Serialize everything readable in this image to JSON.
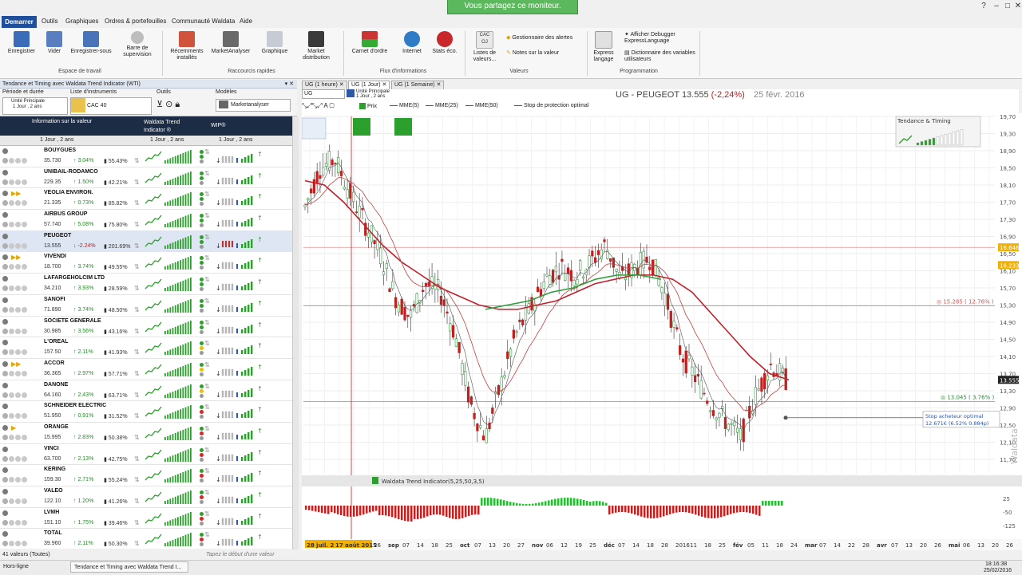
{
  "banner": "Vous partagez ce moniteur.",
  "menu": {
    "demarrer": "Demarrer",
    "items": [
      "Outils",
      "Graphiques",
      "Ordres & portefeuilles",
      "Communauté Waldata",
      "Aide"
    ]
  },
  "ribbon": {
    "buttons": [
      {
        "label": "Enregistrer"
      },
      {
        "label": "Vider"
      },
      {
        "label": "Enregistrer-sous"
      },
      {
        "label": "Barre de supervision"
      },
      {
        "label": "Récemments installés"
      },
      {
        "label": "MarketAnalyser"
      },
      {
        "label": "Graphique"
      },
      {
        "label": "Market distribution"
      },
      {
        "label": "Carnet d'ordre"
      },
      {
        "label": "Internet"
      },
      {
        "label": "Stats éco."
      },
      {
        "label": "Listes de valeurs..."
      },
      {
        "label": "Gestionnaire des alertes"
      },
      {
        "label": "Notes sur la valeur"
      },
      {
        "label": "Express langage"
      },
      {
        "label": "Afficher Debugger ExpressLanguage"
      },
      {
        "label": "Dictionnaire des variables utilisateurs"
      }
    ],
    "groups": [
      "Espace de travail",
      "Raccourcis rapides",
      "Flux d'informations",
      "Valeurs",
      "Programmation"
    ],
    "cac_badge": "CAC OJ"
  },
  "left_panel": {
    "title": "Tendance et Timing avec Waldata Trend Indicator (WTI)",
    "periode_label": "Période et durée",
    "unite": "Unité Principale",
    "periode": "1 Jour , 2 ans",
    "liste_label": "Liste d'instruments",
    "liste_value": "CAC 40",
    "outils_label": "Outils",
    "modeles_label": "Modèles",
    "modeles_value": "Marketanalyser",
    "col_info": "Information sur la valeur",
    "col_wti": "Waldata Trend Indicator ®",
    "col_wip": "WIP®",
    "filter1": "1 Jour , 2 ans",
    "filter2": "1 Jour , 2 ans",
    "filter3": "1 Jour , 2 ans",
    "count": "41 valeurs (Toutes)",
    "type_hint": "Tapez le début d'une valeur"
  },
  "stocks": [
    {
      "name": "BOUYGUES",
      "price": "35.730",
      "pct": "3.04%",
      "vol": "55.43%",
      "dir": "up",
      "dot": "#2ca02c",
      "flag": ""
    },
    {
      "name": "UNIBAIL-RODAMCO",
      "price": "229.35",
      "pct": "1.50%",
      "vol": "42.21%",
      "dir": "up",
      "dot": "#2ca02c",
      "flag": ""
    },
    {
      "name": "VEOLIA ENVIRON.",
      "price": "21.335",
      "pct": "0.73%",
      "vol": "85.82%",
      "dir": "up",
      "dot": "#2ca02c",
      "flag": "arrows"
    },
    {
      "name": "AIRBUS GROUP",
      "price": "57.740",
      "pct": "5.08%",
      "vol": "75.80%",
      "dir": "up",
      "dot": "#2ca02c",
      "flag": ""
    },
    {
      "name": "PEUGEOT",
      "price": "13.555",
      "pct": "-2.24%",
      "vol": "201.69%",
      "dir": "down",
      "dot": "#2ca02c",
      "flag": ""
    },
    {
      "name": "VIVENDI",
      "price": "18.700",
      "pct": "3.74%",
      "vol": "49.55%",
      "dir": "up",
      "dot": "#2ca02c",
      "flag": "arrows"
    },
    {
      "name": "LAFARGEHOLCIM LTD",
      "price": "34.210",
      "pct": "3.93%",
      "vol": "28.59%",
      "dir": "up",
      "dot": "#2ca02c",
      "flag": ""
    },
    {
      "name": "SANOFI",
      "price": "71.890",
      "pct": "3.74%",
      "vol": "48.50%",
      "dir": "up",
      "dot": "#2ca02c",
      "flag": ""
    },
    {
      "name": "SOCIETE GENERALE",
      "price": "30.985",
      "pct": "3.56%",
      "vol": "43.16%",
      "dir": "up",
      "dot": "#2ca02c",
      "flag": ""
    },
    {
      "name": "L'OREAL",
      "price": "157.50",
      "pct": "2.11%",
      "vol": "41.93%",
      "dir": "up",
      "dot": "#e8c000",
      "flag": ""
    },
    {
      "name": "ACCOR",
      "price": "36.365",
      "pct": "2.97%",
      "vol": "57.71%",
      "dir": "up",
      "dot": "#e8c000",
      "flag": "arrows"
    },
    {
      "name": "DANONE",
      "price": "64.160",
      "pct": "2.43%",
      "vol": "63.71%",
      "dir": "up",
      "dot": "#e8c000",
      "flag": ""
    },
    {
      "name": "SCHNEIDER ELECTRIC",
      "price": "51.950",
      "pct": "0.91%",
      "vol": "31.52%",
      "dir": "up",
      "dot": "#d62728",
      "flag": ""
    },
    {
      "name": "ORANGE",
      "price": "15.995",
      "pct": "2.83%",
      "vol": "50.38%",
      "dir": "up",
      "dot": "#d62728",
      "flag": "arrow"
    },
    {
      "name": "VINCI",
      "price": "63.700",
      "pct": "2.13%",
      "vol": "42.75%",
      "dir": "up",
      "dot": "#d62728",
      "flag": ""
    },
    {
      "name": "KERING",
      "price": "159.30",
      "pct": "2.71%",
      "vol": "55.24%",
      "dir": "up",
      "dot": "#d62728",
      "flag": ""
    },
    {
      "name": "VALEO",
      "price": "122.10",
      "pct": "1.20%",
      "vol": "41.26%",
      "dir": "up",
      "dot": "#d62728",
      "flag": ""
    },
    {
      "name": "LVMH",
      "price": "151.10",
      "pct": "1.75%",
      "vol": "39.46%",
      "dir": "up",
      "dot": "#d62728",
      "flag": ""
    },
    {
      "name": "TOTAL",
      "price": "39.960",
      "pct": "2.11%",
      "vol": "50.30%",
      "dir": "up",
      "dot": "#d62728",
      "flag": ""
    }
  ],
  "chart": {
    "tabs": [
      "UG (1 heure)",
      "UG (1 Jour)",
      "UG (1 Semaine)"
    ],
    "symbol_input": "UG",
    "unit": "Unité Principale",
    "unit_period": "1 Jour , 2 ans",
    "legend": [
      "Prix",
      "MME(5)",
      "MME(25)",
      "MME(50)",
      "Stop de protection optimal"
    ],
    "title_name": "UG - PEUGEOT",
    "title_price": "13.555",
    "title_change": "(-2,24%)",
    "title_date": "25 févr. 2016",
    "trend_panel_label": "Tendance & Timing",
    "y_ticks": [
      "19,70",
      "19,30",
      "18,90",
      "18,50",
      "18,10",
      "17,70",
      "17,30",
      "16,90",
      "16,50",
      "16,10",
      "15,70",
      "15,30",
      "14,90",
      "14,50",
      "14,10",
      "13,70",
      "13,30",
      "12,90",
      "12,50",
      "12,10",
      "11,70"
    ],
    "price_badges": [
      "16.646",
      "16.233",
      "13.555"
    ],
    "level_high": "15.285 ( 12.76% )",
    "level_low": "13.045 ( 3.76% )",
    "stop_label_1": "Stop acheteur optimal",
    "stop_label_2": "12.671€ (6.52% 0.884p)",
    "indicator_label": "Waldata Trend Indicator(5,25,50,3,5)",
    "ind_ticks": [
      "25",
      "-50",
      "-125"
    ],
    "x_ticks": [
      "28 juil. 2",
      "17 août 2015",
      "26",
      "sep",
      "07",
      "14",
      "18",
      "25",
      "oct",
      "07",
      "13",
      "20",
      "27",
      "nov",
      "06",
      "12",
      "19",
      "25",
      "déc",
      "07",
      "14",
      "18",
      "28",
      "2016",
      "11",
      "18",
      "25",
      "fév",
      "05",
      "11",
      "18",
      "24",
      "mar",
      "07",
      "14",
      "22",
      "28",
      "avr",
      "07",
      "13",
      "20",
      "26",
      "mai",
      "06",
      "13",
      "20",
      "26"
    ],
    "watermark": "Waldata"
  },
  "status": {
    "left": "Hors-ligne",
    "task": "Tendance et Timing avec Waldata Trend I...",
    "time": "18:16:38",
    "date": "25/02/2016"
  },
  "colors": {
    "mme25": "#c0202a",
    "mme50": "#2e9e3a",
    "wti_pos": "#22c02e",
    "wti_neg": "#c42020"
  },
  "chart_data": {
    "type": "line",
    "series": [
      {
        "name": "Prix",
        "values": [
          17.6,
          18.5,
          18.7,
          17.9,
          17.2,
          16.5,
          15.5,
          15.0,
          15.8,
          15.6,
          14.6,
          13.0,
          12.2,
          13.4,
          14.6,
          15.2,
          15.9,
          16.2,
          16.0,
          16.3,
          16.7,
          15.9,
          16.2,
          16.4,
          15.5,
          14.2,
          13.6,
          13.0,
          12.6,
          12.2,
          13.2,
          13.9,
          13.555
        ]
      },
      {
        "name": "MME(25)",
        "values": [
          18.2,
          18.1,
          17.7,
          17.2,
          16.7,
          16.3,
          16.0,
          15.7,
          15.5,
          15.3,
          15.2,
          15.2,
          15.3,
          15.4,
          15.6,
          15.8,
          15.9,
          16.0,
          16.0,
          15.9,
          15.6,
          15.1,
          14.6,
          14.1,
          13.7,
          13.555
        ]
      },
      {
        "name": "MME(50)",
        "values": [
          15.2,
          15.3,
          15.4,
          15.6,
          15.7,
          15.9,
          16.0,
          16.0,
          15.9
        ]
      }
    ],
    "ylim": [
      11.7,
      19.7
    ]
  }
}
